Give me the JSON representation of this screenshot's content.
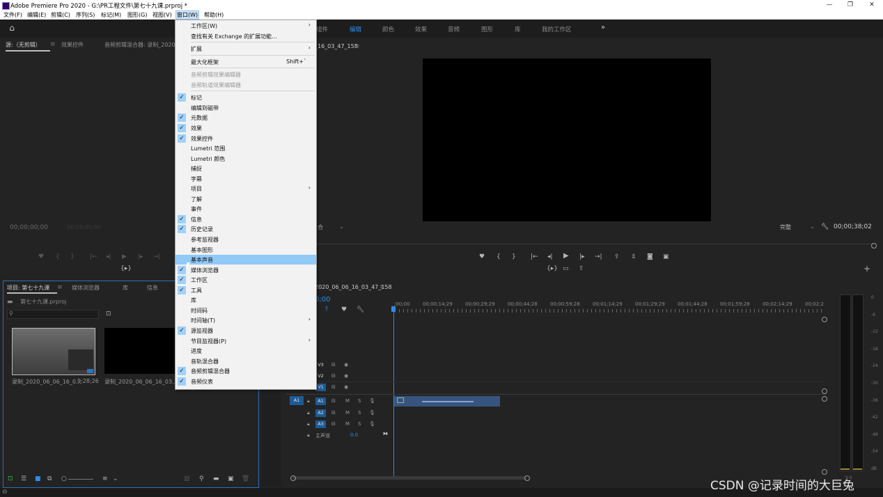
{
  "title_bar": {
    "title": "Adobe Premiere Pro 2020 - G:\\PR工程文件\\第七十九课.prproj *",
    "minimize": "—",
    "restore": "❐",
    "close": "✕"
  },
  "menubar": [
    {
      "label": "文件(F)"
    },
    {
      "label": "编辑(E)"
    },
    {
      "label": "剪辑(C)"
    },
    {
      "label": "序列(S)"
    },
    {
      "label": "标记(M)"
    },
    {
      "label": "图形(G)"
    },
    {
      "label": "视图(V)"
    },
    {
      "label": "窗口(W)"
    },
    {
      "label": "帮助(H)"
    }
  ],
  "workspaces": {
    "items": [
      "组件",
      "编辑",
      "颜色",
      "效果",
      "音频",
      "图形",
      "库",
      "我的工作区"
    ],
    "active": "编辑",
    "more": "»"
  },
  "source_panel": {
    "tabs": [
      "源:（无剪辑）",
      "效果控件",
      "音频剪辑混合器: 录制_2020"
    ],
    "timecode": "00;00;00;00",
    "tc_right": "00;00;00;00",
    "sync": "{▸}"
  },
  "program_panel": {
    "tab": "节目: 录制_2020_06_06_16_03_47_158",
    "tab_visible": "_16_03_47_158",
    "fit": "合",
    "quality": "完整",
    "timecode": "00;00;38;02"
  },
  "project_panel": {
    "tabs": [
      "项目: 第七十九课",
      "媒体浏览器",
      "库",
      "信息"
    ],
    "file": "第七十九课.prproj",
    "items": [
      {
        "name": "录制_2020_06_06_16_0...",
        "duration": "9;28;26"
      },
      {
        "name": "录制_2020_06_06_16_03...",
        "duration": ""
      }
    ]
  },
  "timeline": {
    "tab": "录制_2020_06_06_16_03_47_158",
    "tab_visible": "2020_06_06_16_03_47_158",
    "timecode": "00;00;00;00",
    "timecode_visible": "0;00",
    "ruler": [
      ";00;00",
      "00;00;14;29",
      "00;00;29;29",
      "00;00;44;28",
      "00;00;59;28",
      "00;01;14;29",
      "00;01;29;29",
      "00;01;44;28",
      "00;01;59;28",
      "00;02;14;29",
      "00;02;2"
    ],
    "video_tracks": [
      "V3",
      "V2",
      "V1"
    ],
    "audio_tracks": [
      "A1",
      "A2",
      "A3"
    ],
    "master": {
      "label": "主声道",
      "value": "0.0"
    },
    "source_patch": "A1"
  },
  "audio_meter": {
    "ticks": [
      "0",
      "-6",
      "-12",
      "-18",
      "-24",
      "-30",
      "-36",
      "-42",
      "-48",
      "-54",
      "dB"
    ],
    "solo": "S  S"
  },
  "window_menu": {
    "items": [
      {
        "label": "工作区(W)",
        "submenu": true
      },
      {
        "label": "查找有关 Exchange 的扩展功能..."
      },
      {
        "sep": true
      },
      {
        "label": "扩展",
        "submenu": true
      },
      {
        "sep": true
      },
      {
        "label": "最大化框架",
        "shortcut": "Shift+`"
      },
      {
        "sep": true
      },
      {
        "label": "音频剪辑效果编辑器",
        "disabled": true
      },
      {
        "label": "音频轨道效果编辑器",
        "disabled": true
      },
      {
        "sep": true
      },
      {
        "label": "标记",
        "checked": true
      },
      {
        "label": "编辑到磁带"
      },
      {
        "label": "元数据",
        "checked": true
      },
      {
        "label": "效果",
        "checked": true
      },
      {
        "label": "效果控件",
        "checked": true
      },
      {
        "label": "Lumetri 范围"
      },
      {
        "label": "Lumetri 颜色"
      },
      {
        "label": "捕捉"
      },
      {
        "label": "字幕"
      },
      {
        "label": "项目",
        "submenu": true
      },
      {
        "label": "了解"
      },
      {
        "label": "事件"
      },
      {
        "label": "信息",
        "checked": true
      },
      {
        "label": "历史记录",
        "checked": true
      },
      {
        "label": "参考监视器"
      },
      {
        "label": "基本图形"
      },
      {
        "label": "基本声音",
        "highlighted": true
      },
      {
        "label": "媒体浏览器",
        "checked": true
      },
      {
        "label": "工作区",
        "checked": true
      },
      {
        "label": "工具",
        "checked": true
      },
      {
        "label": "库"
      },
      {
        "label": "时间码"
      },
      {
        "label": "时间轴(T)",
        "submenu": true
      },
      {
        "label": "源监视器",
        "checked": true
      },
      {
        "label": "节目监视器(P)",
        "submenu": true
      },
      {
        "label": "进度"
      },
      {
        "label": "音轨混合器"
      },
      {
        "label": "音频剪辑混合器",
        "checked": true
      },
      {
        "label": "音频仪表",
        "checked": true
      }
    ]
  },
  "watermark": "CSDN @记录时间的大巨兔",
  "colors": {
    "accent": "#2d8ceb",
    "menu_highlight": "#91c9f7",
    "check_bg": "#9fd1fb",
    "panel": "#232323"
  }
}
